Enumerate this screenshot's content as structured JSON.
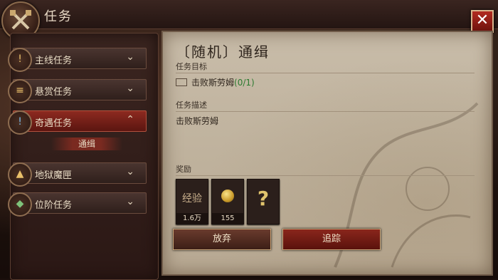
{
  "header": {
    "title": "任务"
  },
  "sidebar": {
    "items": [
      {
        "label": "主线任务",
        "icon": "quest-red-icon",
        "expanded": false
      },
      {
        "label": "悬赏任务",
        "icon": "scroll-icon",
        "expanded": false
      },
      {
        "label": "奇遇任务",
        "icon": "rune-blue-icon",
        "expanded": true
      },
      {
        "label": "地狱魔匣",
        "icon": "chest-icon",
        "expanded": false
      },
      {
        "label": "位阶任务",
        "icon": "rank-green-icon",
        "expanded": false
      }
    ],
    "sub_item": "通缉"
  },
  "quest": {
    "name": "〔随机〕通缉",
    "objective_header": "任务目标",
    "objective": "击败斯劳姆",
    "progress": "(0/1)",
    "desc_header": "任务描述",
    "desc": "击败斯劳姆",
    "reward_header": "奖励"
  },
  "rewards": [
    {
      "name": "经验",
      "amount": "1.6万"
    },
    {
      "name": "coin",
      "amount": "155"
    },
    {
      "name": "?",
      "amount": ""
    }
  ],
  "actions": {
    "abandon": "放弃",
    "track": "追踪"
  }
}
